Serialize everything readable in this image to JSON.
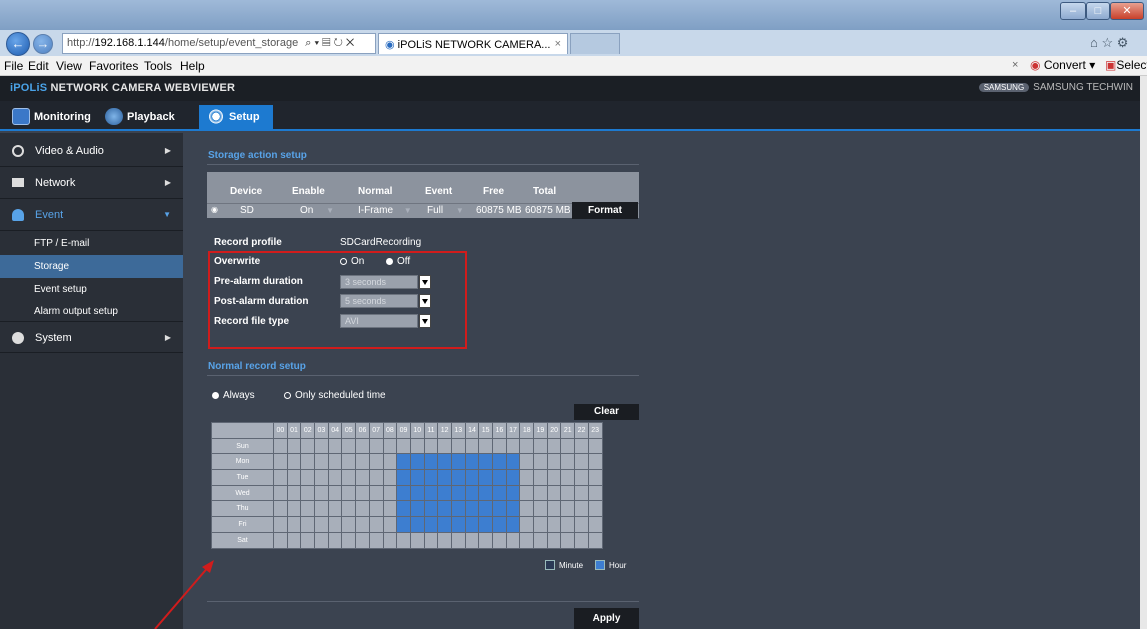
{
  "browser": {
    "address": "http://",
    "address_host": "192.168.1.144",
    "address_path": "/home/setup/event_storage",
    "address_tools": "⌕ ▾ ▤ ↻ ✕",
    "tab_title": "iPOLiS NETWORK CAMERA...",
    "tab_close": "×",
    "menu": [
      "File",
      "Edit",
      "View",
      "Favorites",
      "Tools",
      "Help"
    ],
    "convert_label": "Convert",
    "select_label": "Select",
    "right_icons": "⌂ ☆ ⚙",
    "window_buttons": [
      "–",
      "□",
      "✕"
    ]
  },
  "app": {
    "title_brand": "iPOLiS",
    "title_rest": " NETWORK CAMERA WEBVIEWER",
    "logo_text": "SAMSUNG TECHWIN",
    "logo_pill": "SAMSUNG"
  },
  "topnav": {
    "monitoring": "Monitoring",
    "playback": "Playback",
    "setup": "Setup"
  },
  "sidebar": {
    "video_audio": "Video & Audio",
    "network": "Network",
    "event": "Event",
    "ftp": "FTP / E-mail",
    "storage": "Storage",
    "event_setup": "Event setup",
    "alarm_output": "Alarm output setup",
    "system": "System"
  },
  "storage": {
    "title": "Storage action setup",
    "headers": [
      "Device",
      "Enable",
      "Normal",
      "Event",
      "Free",
      "Total"
    ],
    "row": {
      "device": "SD",
      "enable": "On",
      "normal": "I-Frame",
      "event": "Full",
      "free": "60875 MB",
      "total": "60875 MB"
    },
    "format": "Format"
  },
  "profile": {
    "record_profile_label": "Record profile",
    "record_profile_value": "SDCardRecording",
    "overwrite_label": "Overwrite",
    "overwrite_on": "On",
    "overwrite_off": "Off",
    "pre_alarm_label": "Pre-alarm duration",
    "pre_alarm_value": "3 seconds",
    "post_alarm_label": "Post-alarm duration",
    "post_alarm_value": "5 seconds",
    "file_type_label": "Record file type",
    "file_type_value": "AVI"
  },
  "normal_record": {
    "title": "Normal record setup",
    "always": "Always",
    "scheduled": "Only scheduled time",
    "clear": "Clear",
    "hours": [
      "00",
      "01",
      "02",
      "03",
      "04",
      "05",
      "06",
      "07",
      "08",
      "09",
      "10",
      "11",
      "12",
      "13",
      "14",
      "15",
      "16",
      "17",
      "18",
      "19",
      "20",
      "21",
      "22",
      "23"
    ],
    "days": [
      "Sun",
      "Mon",
      "Tue",
      "Wed",
      "Thu",
      "Fri",
      "Sat"
    ],
    "selected_days": [
      "Mon",
      "Tue",
      "Wed",
      "Thu",
      "Fri"
    ],
    "selected_hours": [
      9,
      10,
      11,
      12,
      13,
      14,
      15,
      16,
      17
    ],
    "legend_minute": "Minute",
    "legend_hour": "Hour",
    "apply": "Apply"
  },
  "colors": {
    "accent": "#1d7ad0",
    "highlight_box": "#d11c1c",
    "schedule_selected": "#3d7ed0"
  }
}
